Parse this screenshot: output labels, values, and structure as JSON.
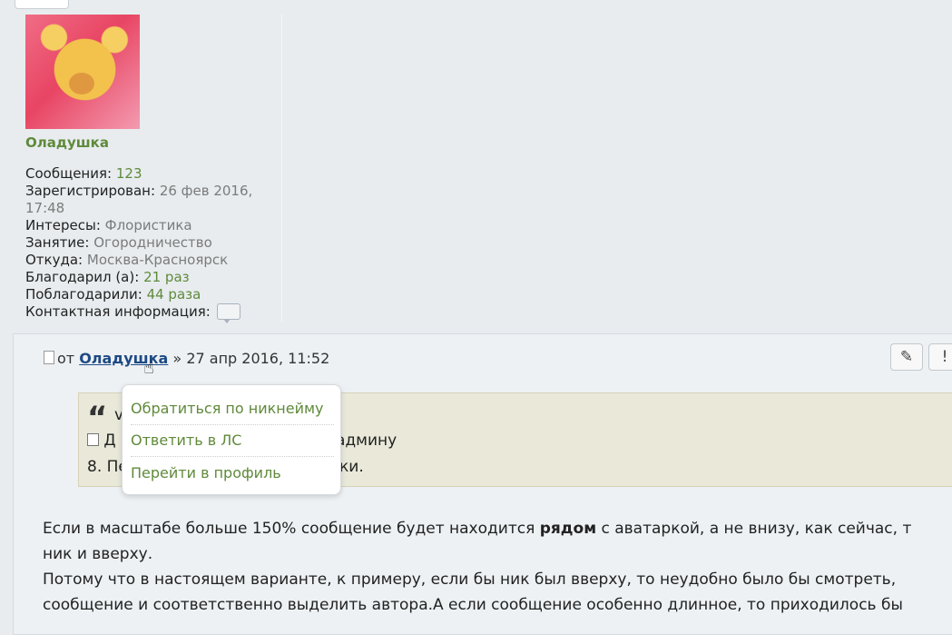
{
  "profile": {
    "username": "Оладушка",
    "posts_label": "Сообщения:",
    "posts_value": "123",
    "registered_label": "Зарегистрирован:",
    "registered_value_1": "26 фев 2016,",
    "registered_value_2": "17:48",
    "interests_label": "Интересы:",
    "interests_value": "Флористика",
    "occupation_label": "Занятие:",
    "occupation_value": "Огородничество",
    "location_label": "Откуда:",
    "location_value": "Москва-Красноярск",
    "thanked_label": "Благодарил (а):",
    "thanked_value": "21 раз",
    "was_thanked_label": "Поблагодарили:",
    "was_thanked_value": "44 раза",
    "contact_label": "Контактная информация:"
  },
  "post": {
    "from_label": "от",
    "author": "Оладушка",
    "separator": "»",
    "date": "27 апр 2016, 11:52",
    "edit_icon": "✎",
    "report_icon": "!"
  },
  "quote": {
    "mark": "“",
    "line1_prefix": "v",
    "line2_prefix": "Д",
    "line2_suffix": "админу",
    "line3_prefix": "8. Пе",
    "line3_suffix": "ки."
  },
  "popup": {
    "items": [
      "Обратиться по никнейму",
      "Ответить в ЛС",
      "Перейти в профиль"
    ]
  },
  "body": {
    "line1_a": "Если в масштабе больше 150% сообщение будет находится ",
    "line1_bold": "рядом",
    "line1_b": " с аватаркой, а не внизу, как сейчас, т",
    "line2": "ник и вверху.",
    "line3": "Потому что в настоящем варианте, к примеру, если бы ник был вверху, то неудобно было бы смотреть,",
    "line4": "сообщение и соответственно выделить автора.А если сообщение особенно длинное, то приходилось бы"
  },
  "colors": {
    "accent_green": "#5f8a3a",
    "link_blue": "#1e4a84",
    "quote_bg": "#e9e8d9"
  }
}
